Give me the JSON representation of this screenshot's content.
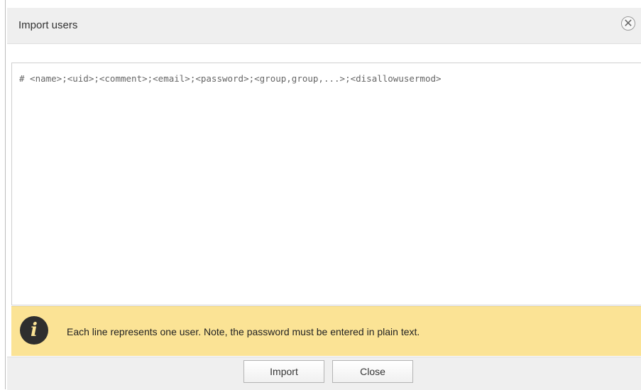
{
  "dialog": {
    "title": "Import users",
    "close_icon_glyph": "✕",
    "close_icon": "close-circle-icon"
  },
  "editor": {
    "value": "# <name>;<uid>;<comment>;<email>;<password>;<group,group,...>;<disallowusermod>"
  },
  "info": {
    "icon": "info-icon",
    "icon_glyph": "i",
    "message": "Each line represents one user. Note, the password must be entered in plain text."
  },
  "buttons": {
    "import_label": "Import",
    "close_label": "Close"
  },
  "colors": {
    "info_background": "#fbe395",
    "titlebar_background": "#efefef"
  }
}
